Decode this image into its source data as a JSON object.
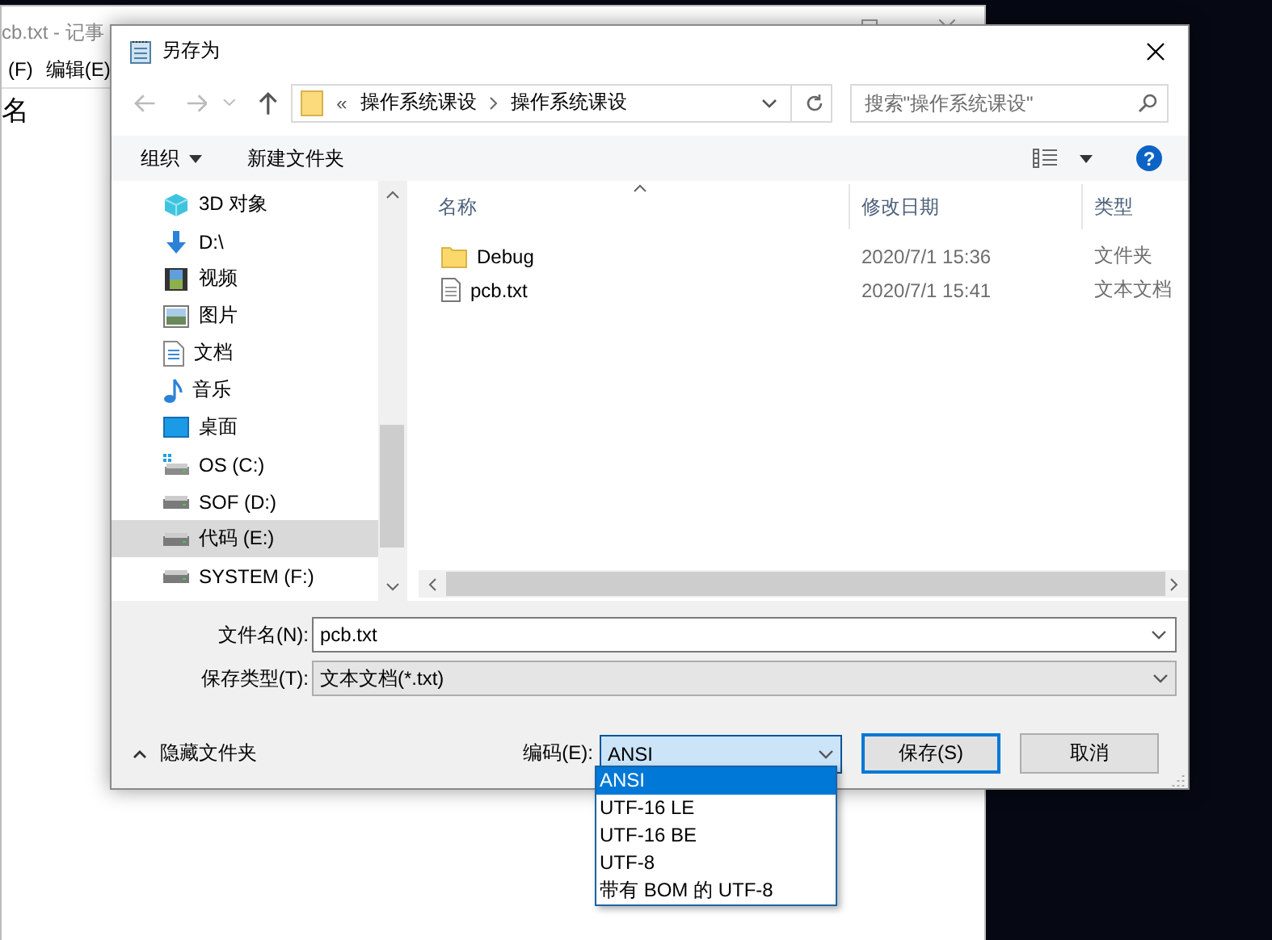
{
  "background_window": {
    "title": "cb.txt - 记事",
    "menu": [
      "(F)",
      "编辑(E)"
    ],
    "content": "名"
  },
  "dialog": {
    "title": "另存为",
    "address": {
      "crumbs": [
        "«",
        "操作系统课设",
        "操作系统课设"
      ]
    },
    "search": {
      "placeholder": "搜索\"操作系统课设\""
    },
    "toolbar": {
      "organize": "组织",
      "new_folder": "新建文件夹",
      "help": "?"
    },
    "nav_items": [
      {
        "kind": "cube",
        "label": "3D 对象",
        "selected": false
      },
      {
        "kind": "download",
        "label": "D:\\",
        "selected": false
      },
      {
        "kind": "video",
        "label": "视频",
        "selected": false
      },
      {
        "kind": "picture",
        "label": "图片",
        "selected": false
      },
      {
        "kind": "document",
        "label": "文档",
        "selected": false
      },
      {
        "kind": "music",
        "label": "音乐",
        "selected": false
      },
      {
        "kind": "desktop",
        "label": "桌面",
        "selected": false
      },
      {
        "kind": "system-drive",
        "label": "OS (C:)",
        "selected": false
      },
      {
        "kind": "drive",
        "label": "SOF (D:)",
        "selected": false
      },
      {
        "kind": "drive",
        "label": "代码 (E:)",
        "selected": true
      },
      {
        "kind": "drive",
        "label": "SYSTEM (F:)",
        "selected": false
      }
    ],
    "columns": [
      "名称",
      "修改日期",
      "类型"
    ],
    "files": [
      {
        "kind": "folder",
        "name": "Debug",
        "modified": "2020/7/1 15:36",
        "type": "文件夹"
      },
      {
        "kind": "text",
        "name": "pcb.txt",
        "modified": "2020/7/1 15:41",
        "type": "文本文档"
      }
    ],
    "filename": {
      "label": "文件名(N):",
      "value": "pcb.txt"
    },
    "file_type": {
      "label": "保存类型(T):",
      "value": "文本文档(*.txt)"
    },
    "hide_folders": "隐藏文件夹",
    "encoding": {
      "label": "编码(E):",
      "value": "ANSI",
      "options": [
        {
          "label": "ANSI",
          "selected": true
        },
        {
          "label": "UTF-16 LE",
          "selected": false
        },
        {
          "label": "UTF-16 BE",
          "selected": false
        },
        {
          "label": "UTF-8",
          "selected": false
        },
        {
          "label": "带有 BOM 的 UTF-8",
          "selected": false
        }
      ]
    },
    "buttons": [
      {
        "kind": "default",
        "label": "保存(S)"
      },
      {
        "kind": "normal",
        "label": "取消"
      }
    ]
  }
}
